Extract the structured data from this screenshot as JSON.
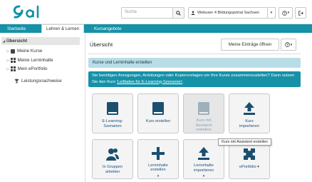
{
  "header": {
    "logo_text": "olat",
    "search_placeholder": "Suche",
    "user_label": "Webuser 4 Bildungsportal Sachsen",
    "help_icon": "question-circle-icon",
    "logout_icon": "sign-out-icon"
  },
  "nav": {
    "tabs": [
      {
        "label": "Startseite"
      },
      {
        "label": "Lehren & Lernen"
      },
      {
        "label": "Kursangebote"
      }
    ]
  },
  "sidebar": {
    "items": [
      {
        "label": "Übersicht"
      },
      {
        "label": "Meine Kurse"
      },
      {
        "label": "Meine Lerninhalte"
      },
      {
        "label": "Mein ePortfolio"
      },
      {
        "label": "Leistungsnachweise"
      }
    ]
  },
  "main": {
    "title": "Übersicht",
    "meine_eintraege_label": "Meine Einträge öffnen",
    "info_light": "Kurse und Lerninhalte erstellen",
    "info_dark_text": "Sie benötigen Anregungen, Anleitungen oder Kopiervorlagen um Ihre Kurse zusammenzustellen? Dann nutzen Sie den Kurs ",
    "info_dark_link": "'Leitfaden für E-Learning-Szenarien'",
    "info_dark_end": ".",
    "tiles": [
      {
        "label1": "E-Learning-",
        "label2": "Szenarien",
        "label3": "",
        "caret": "",
        "icon": "book-icon"
      },
      {
        "label1": "Kurs erstellen",
        "label2": "",
        "label3": "",
        "caret": "",
        "icon": "book-icon"
      },
      {
        "label1": "Kurs mit",
        "label2": "Assistent",
        "label3": "erstellen",
        "caret": "",
        "icon": "book-icon"
      },
      {
        "label1": "Kurs",
        "label2": "importieren",
        "label3": "",
        "caret": "",
        "icon": "upload-icon"
      },
      {
        "label1": "In Gruppen",
        "label2": "arbeiten",
        "label3": "",
        "caret": "",
        "icon": "users-icon"
      },
      {
        "label1": "Lerninhalte",
        "label2": "erstellen",
        "label3": "",
        "caret": "▾",
        "icon": "plus-icon"
      },
      {
        "label1": "Lerninhalte",
        "label2": "importieren",
        "label3": "",
        "caret": "▾",
        "icon": "upload-icon"
      },
      {
        "label1": "ePortfolio ▾",
        "label2": "",
        "label3": "",
        "caret": "",
        "icon": "puzzle-icon"
      }
    ],
    "tooltip": "Kurs mit Assistent erstellen"
  },
  "colors": {
    "brand": "#1591a8",
    "info_light": "#b8dde6",
    "icon_dark": "#1b4f6e"
  }
}
